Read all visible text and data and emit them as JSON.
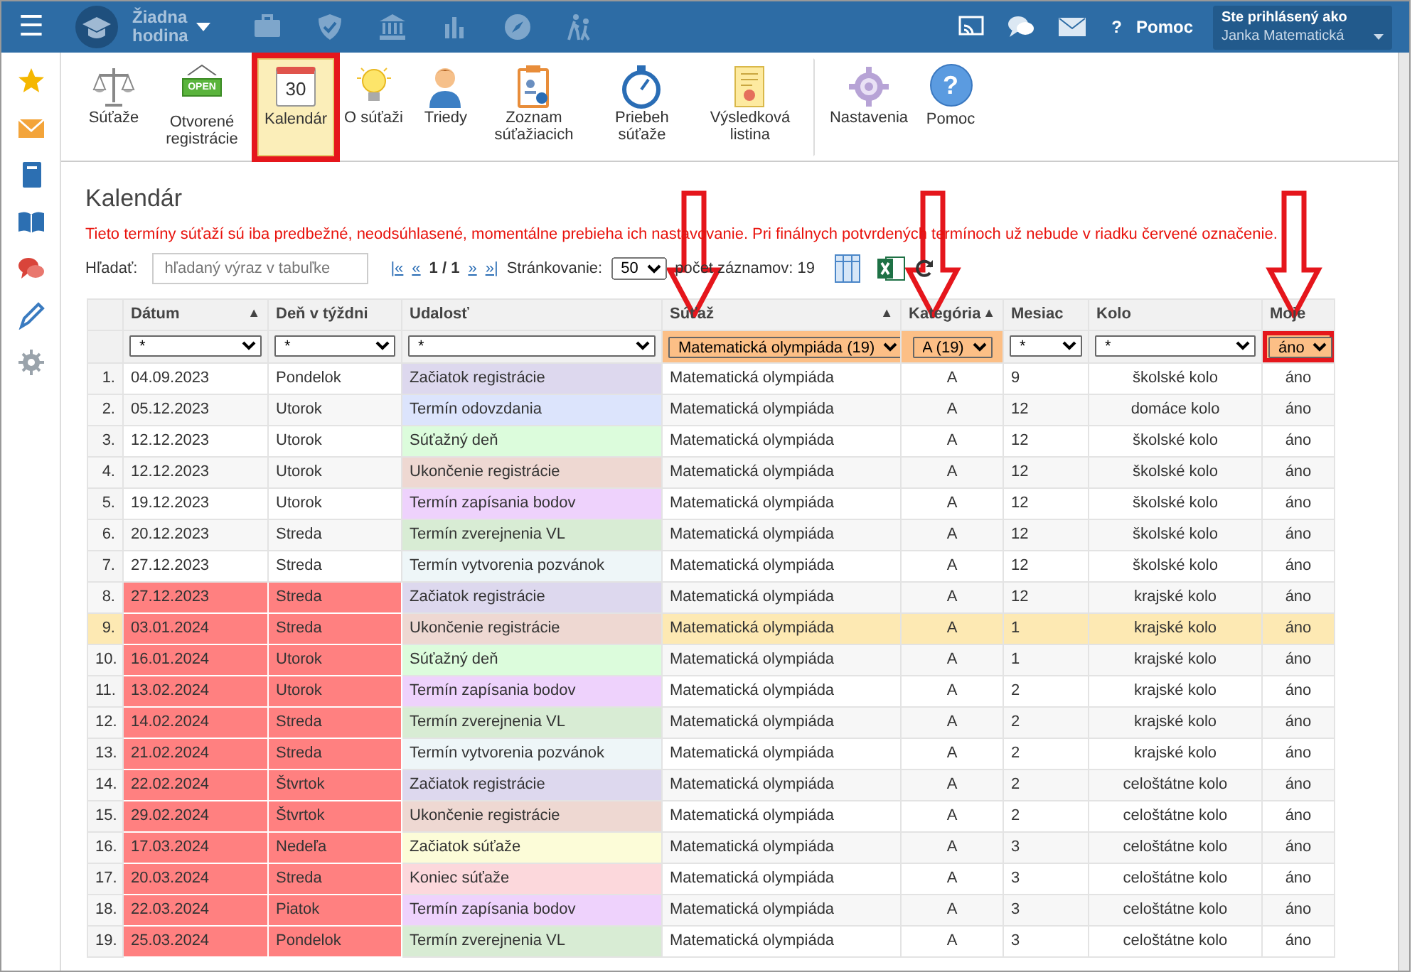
{
  "navbar": {
    "menu": "☰",
    "period": {
      "line1": "Žiadna",
      "line2": "hodina"
    },
    "help": {
      "mark": "?",
      "label": "Pomoc"
    },
    "user": {
      "caption": "Ste prihlásený ako",
      "name": "Janka Matematická"
    }
  },
  "toolbar": [
    {
      "label": "Súťaže",
      "selected": false,
      "annotated": false
    },
    {
      "label": "Otvorené registrácie",
      "icon_text": "OPEN",
      "selected": false,
      "annotated": false
    },
    {
      "label": "Kalendár",
      "icon_text": "30",
      "selected": true,
      "annotated": true
    },
    {
      "label": "O súťaži",
      "selected": false,
      "annotated": false
    },
    {
      "label": "Triedy",
      "selected": false,
      "annotated": false
    },
    {
      "label": "Zoznam súťažiacich",
      "selected": false,
      "annotated": false
    },
    {
      "label": "Priebeh súťaže",
      "selected": false,
      "annotated": false
    },
    {
      "label": "Výsledková listina",
      "selected": false,
      "annotated": false
    },
    {
      "label": "Nastavenia",
      "selected": false,
      "annotated": false,
      "group_start": true
    },
    {
      "label": "Pomoc",
      "icon_text": "?",
      "selected": false,
      "annotated": false
    }
  ],
  "page_title": "Kalendár",
  "warning": "Tieto termíny súťaží sú iba predbežné, neodsúhlasené, momentálne prebieha ich nastavovanie. Pri finálnych potvrdených termínoch už nebude v riadku červené označenie.",
  "search": {
    "label": "Hľadať:",
    "placeholder": "hľadaný výraz v tabuľke"
  },
  "pager": {
    "first": "|«",
    "prev": "«",
    "page": "1 / 1",
    "next": "»",
    "last": "»|",
    "page_size_label": "Stránkovanie:",
    "page_size": "50",
    "count": "počet záznamov: 19"
  },
  "table": {
    "columns": [
      {
        "label": "Dátum",
        "sort": "▲",
        "filter": "*",
        "filter_active": false,
        "arrow": false,
        "annotated": false
      },
      {
        "label": "Deň v týždni",
        "filter": "*",
        "filter_active": false,
        "arrow": false,
        "annotated": false
      },
      {
        "label": "Udalosť",
        "filter": "*",
        "filter_active": false,
        "arrow": false,
        "annotated": false
      },
      {
        "label": "Súťaž",
        "sort": "▲",
        "filter": "Matematická olympiáda (19)",
        "filter_active": true,
        "arrow": true,
        "annotated": false
      },
      {
        "label": "Kategória",
        "sort": "▲",
        "filter": "A (19)",
        "filter_active": true,
        "arrow": true,
        "annotated": false
      },
      {
        "label": "Mesiac",
        "filter": "*",
        "filter_active": false,
        "arrow": false,
        "annotated": false
      },
      {
        "label": "Kolo",
        "filter": "*",
        "filter_active": false,
        "arrow": false,
        "annotated": false
      },
      {
        "label": "Moje",
        "filter": "áno",
        "filter_active": true,
        "arrow": true,
        "annotated": true
      }
    ],
    "rows": [
      {
        "no": "1.",
        "date": "04.09.2023",
        "day": "Pondelok",
        "event": "Začiatok registrácie",
        "color": "#ddd8ee",
        "competition": "Matematická olympiáda",
        "category": "A",
        "month": "9",
        "round": "školské kolo",
        "mine": "áno",
        "overdue": false,
        "selected": false
      },
      {
        "no": "2.",
        "date": "05.12.2023",
        "day": "Utorok",
        "event": "Termín odovzdania",
        "color": "#dce4fc",
        "competition": "Matematická olympiáda",
        "category": "A",
        "month": "12",
        "round": "domáce kolo",
        "mine": "áno",
        "overdue": false,
        "selected": false
      },
      {
        "no": "3.",
        "date": "12.12.2023",
        "day": "Utorok",
        "event": "Súťažný deň",
        "color": "#dcfcdc",
        "competition": "Matematická olympiáda",
        "category": "A",
        "month": "12",
        "round": "školské kolo",
        "mine": "áno",
        "overdue": false,
        "selected": false
      },
      {
        "no": "4.",
        "date": "12.12.2023",
        "day": "Utorok",
        "event": "Ukončenie registrácie",
        "color": "#eed8d2",
        "competition": "Matematická olympiáda",
        "category": "A",
        "month": "12",
        "round": "školské kolo",
        "mine": "áno",
        "overdue": false,
        "selected": false
      },
      {
        "no": "5.",
        "date": "19.12.2023",
        "day": "Utorok",
        "event": "Termín zapísania bodov",
        "color": "#eed2fc",
        "competition": "Matematická olympiáda",
        "category": "A",
        "month": "12",
        "round": "školské kolo",
        "mine": "áno",
        "overdue": false,
        "selected": false
      },
      {
        "no": "6.",
        "date": "20.12.2023",
        "day": "Streda",
        "event": "Termín zverejnenia VL",
        "color": "#d8ecd4",
        "competition": "Matematická olympiáda",
        "category": "A",
        "month": "12",
        "round": "školské kolo",
        "mine": "áno",
        "overdue": false,
        "selected": false
      },
      {
        "no": "7.",
        "date": "27.12.2023",
        "day": "Streda",
        "event": "Termín vytvorenia pozvánok",
        "color": "#eef6f8",
        "competition": "Matematická olympiáda",
        "category": "A",
        "month": "12",
        "round": "školské kolo",
        "mine": "áno",
        "overdue": false,
        "selected": false
      },
      {
        "no": "8.",
        "date": "27.12.2023",
        "day": "Streda",
        "event": "Začiatok registrácie",
        "color": "#ddd8ee",
        "competition": "Matematická olympiáda",
        "category": "A",
        "month": "12",
        "round": "krajské kolo",
        "mine": "áno",
        "overdue": true,
        "selected": false
      },
      {
        "no": "9.",
        "date": "03.01.2024",
        "day": "Streda",
        "event": "Ukončenie registrácie",
        "color": "#eed8d2",
        "competition": "Matematická olympiáda",
        "category": "A",
        "month": "1",
        "round": "krajské kolo",
        "mine": "áno",
        "overdue": true,
        "selected": true
      },
      {
        "no": "10.",
        "date": "16.01.2024",
        "day": "Utorok",
        "event": "Súťažný deň",
        "color": "#dcfcdc",
        "competition": "Matematická olympiáda",
        "category": "A",
        "month": "1",
        "round": "krajské kolo",
        "mine": "áno",
        "overdue": true,
        "selected": false
      },
      {
        "no": "11.",
        "date": "13.02.2024",
        "day": "Utorok",
        "event": "Termín zapísania bodov",
        "color": "#eed2fc",
        "competition": "Matematická olympiáda",
        "category": "A",
        "month": "2",
        "round": "krajské kolo",
        "mine": "áno",
        "overdue": true,
        "selected": false
      },
      {
        "no": "12.",
        "date": "14.02.2024",
        "day": "Streda",
        "event": "Termín zverejnenia VL",
        "color": "#d8ecd4",
        "competition": "Matematická olympiáda",
        "category": "A",
        "month": "2",
        "round": "krajské kolo",
        "mine": "áno",
        "overdue": true,
        "selected": false
      },
      {
        "no": "13.",
        "date": "21.02.2024",
        "day": "Streda",
        "event": "Termín vytvorenia pozvánok",
        "color": "#eef6f8",
        "competition": "Matematická olympiáda",
        "category": "A",
        "month": "2",
        "round": "krajské kolo",
        "mine": "áno",
        "overdue": true,
        "selected": false
      },
      {
        "no": "14.",
        "date": "22.02.2024",
        "day": "Štvrtok",
        "event": "Začiatok registrácie",
        "color": "#ddd8ee",
        "competition": "Matematická olympiáda",
        "category": "A",
        "month": "2",
        "round": "celoštátne kolo",
        "mine": "áno",
        "overdue": true,
        "selected": false
      },
      {
        "no": "15.",
        "date": "29.02.2024",
        "day": "Štvrtok",
        "event": "Ukončenie registrácie",
        "color": "#eed8d2",
        "competition": "Matematická olympiáda",
        "category": "A",
        "month": "2",
        "round": "celoštátne kolo",
        "mine": "áno",
        "overdue": true,
        "selected": false
      },
      {
        "no": "16.",
        "date": "17.03.2024",
        "day": "Nedeľa",
        "event": "Začiatok súťaže",
        "color": "#fcfcd8",
        "competition": "Matematická olympiáda",
        "category": "A",
        "month": "3",
        "round": "celoštátne kolo",
        "mine": "áno",
        "overdue": true,
        "selected": false
      },
      {
        "no": "17.",
        "date": "20.03.2024",
        "day": "Streda",
        "event": "Koniec súťaže",
        "color": "#fcd8dc",
        "competition": "Matematická olympiáda",
        "category": "A",
        "month": "3",
        "round": "celoštátne kolo",
        "mine": "áno",
        "overdue": true,
        "selected": false
      },
      {
        "no": "18.",
        "date": "22.03.2024",
        "day": "Piatok",
        "event": "Termín zapísania bodov",
        "color": "#eed2fc",
        "competition": "Matematická olympiáda",
        "category": "A",
        "month": "3",
        "round": "celoštátne kolo",
        "mine": "áno",
        "overdue": true,
        "selected": false
      },
      {
        "no": "19.",
        "date": "25.03.2024",
        "day": "Pondelok",
        "event": "Termín zverejnenia VL",
        "color": "#d8ecd4",
        "competition": "Matematická olympiáda",
        "category": "A",
        "month": "3",
        "round": "celoštátne kolo",
        "mine": "áno",
        "overdue": true,
        "selected": false
      }
    ]
  }
}
